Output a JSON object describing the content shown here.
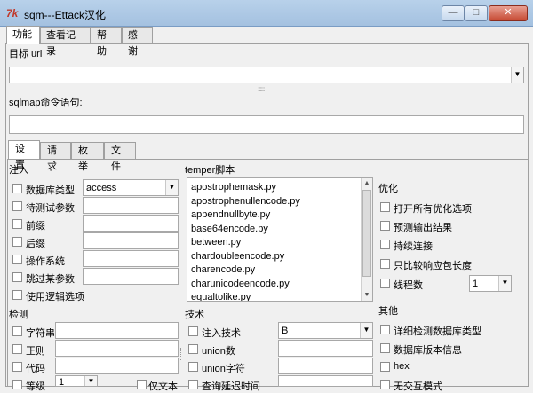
{
  "window": {
    "title": "sqm---Ettack汉化",
    "controls": [
      "—",
      "□",
      "✕"
    ]
  },
  "top_tabs": [
    "功能",
    "查看记录",
    "帮助",
    "感谢"
  ],
  "target_url": {
    "label": "目标 url",
    "value": ""
  },
  "sqlmap_cmd": {
    "label": "sqlmap命令语句:",
    "value": ""
  },
  "inner_tabs": [
    "设置",
    "请求",
    "枚举",
    "文件"
  ],
  "inject": {
    "title": "注入",
    "rows": [
      {
        "label": "数据库类型",
        "value": "access",
        "dropdown": true
      },
      {
        "label": "待测试参数",
        "value": ""
      },
      {
        "label": "前缀",
        "value": ""
      },
      {
        "label": "后缀",
        "value": ""
      },
      {
        "label": "操作系统",
        "value": ""
      },
      {
        "label": "跳过某参数",
        "value": ""
      }
    ],
    "logic_label": "使用逻辑选项"
  },
  "tamper": {
    "title": "temper脚本",
    "items": [
      "apostrophemask.py",
      "apostrophenullencode.py",
      "appendnullbyte.py",
      "base64encode.py",
      "between.py",
      "chardoubleencode.py",
      "charencode.py",
      "charunicodeencode.py",
      "equaltolike.py"
    ]
  },
  "optimize": {
    "title": "优化",
    "items": [
      "打开所有优化选项",
      "预测输出结果",
      "持续连接",
      "只比较响应包长度",
      "线程数"
    ],
    "threads_value": "1"
  },
  "detect": {
    "title": "检测",
    "rows": [
      "字符串",
      "正则",
      "代码",
      "等级"
    ],
    "level_value": "1",
    "text_only_label": "仅文本"
  },
  "technique": {
    "title": "技术",
    "rows": [
      "注入技术",
      "union数",
      "union字符",
      "查询延迟时间"
    ],
    "technique_value": "B"
  },
  "other": {
    "title": "其他",
    "items": [
      "详细检测数据库类型",
      "数据库版本信息",
      "hex",
      "无交互模式"
    ]
  }
}
